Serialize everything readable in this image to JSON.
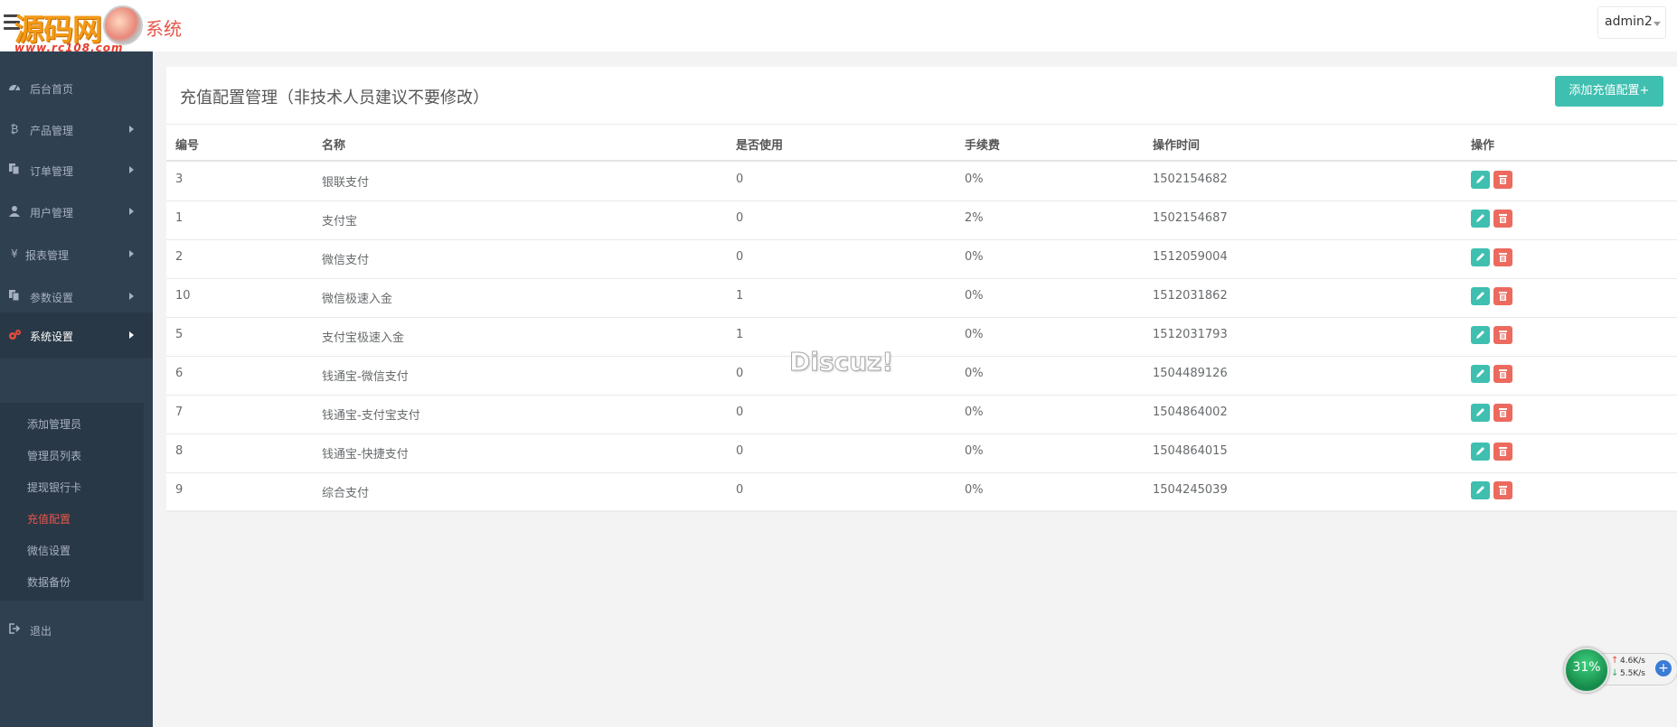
{
  "header": {
    "logo_watermark": "源码网",
    "logo_url": "www.rc108.com",
    "system_suffix": "系统",
    "user": "admin2"
  },
  "sidebar": {
    "items": [
      {
        "label": "后台首页",
        "icon": "dashboard-icon"
      },
      {
        "label": "产品管理",
        "icon": "bitcoin-icon"
      },
      {
        "label": "订单管理",
        "icon": "copy-icon"
      },
      {
        "label": "用户管理",
        "icon": "user-icon"
      },
      {
        "label": "报表管理",
        "icon": "yen-icon"
      },
      {
        "label": "参数设置",
        "icon": "copy-icon"
      },
      {
        "label": "系统设置",
        "icon": "gears-icon"
      },
      {
        "label": "退出",
        "icon": "sign-out-icon"
      }
    ],
    "submenu": [
      "添加管理员",
      "管理员列表",
      "提现银行卡",
      "充值配置",
      "微信设置",
      "数据备份"
    ]
  },
  "panel": {
    "title": "充值配置管理（非技术人员建议不要修改）",
    "add_button": "添加充值配置+",
    "columns": [
      "编号",
      "名称",
      "是否使用",
      "手续费",
      "操作时间",
      "操作"
    ],
    "rows": [
      {
        "id": "3",
        "name": "银联支付",
        "used": "0",
        "fee": "0%",
        "time": "1502154682"
      },
      {
        "id": "1",
        "name": "支付宝",
        "used": "0",
        "fee": "2%",
        "time": "1502154687"
      },
      {
        "id": "2",
        "name": "微信支付",
        "used": "0",
        "fee": "0%",
        "time": "1512059004"
      },
      {
        "id": "10",
        "name": "微信极速入金",
        "used": "1",
        "fee": "0%",
        "time": "1512031862"
      },
      {
        "id": "5",
        "name": "支付宝极速入金",
        "used": "1",
        "fee": "0%",
        "time": "1512031793"
      },
      {
        "id": "6",
        "name": "钱通宝-微信支付",
        "used": "0",
        "fee": "0%",
        "time": "1504489126"
      },
      {
        "id": "7",
        "name": "钱通宝-支付宝支付",
        "used": "0",
        "fee": "0%",
        "time": "1504864002"
      },
      {
        "id": "8",
        "name": "钱通宝-快捷支付",
        "used": "0",
        "fee": "0%",
        "time": "1504864015"
      },
      {
        "id": "9",
        "name": "综合支付",
        "used": "0",
        "fee": "0%",
        "time": "1504245039"
      }
    ]
  },
  "watermark": "Discuz!",
  "net_widget": {
    "cpu": "31%",
    "up": "4.6K/s",
    "down": "5.5K/s"
  },
  "colors": {
    "sidebar": "#2f4050",
    "accent": "#3fbfb0",
    "danger": "#ec6a5e",
    "active": "#e8564a"
  }
}
